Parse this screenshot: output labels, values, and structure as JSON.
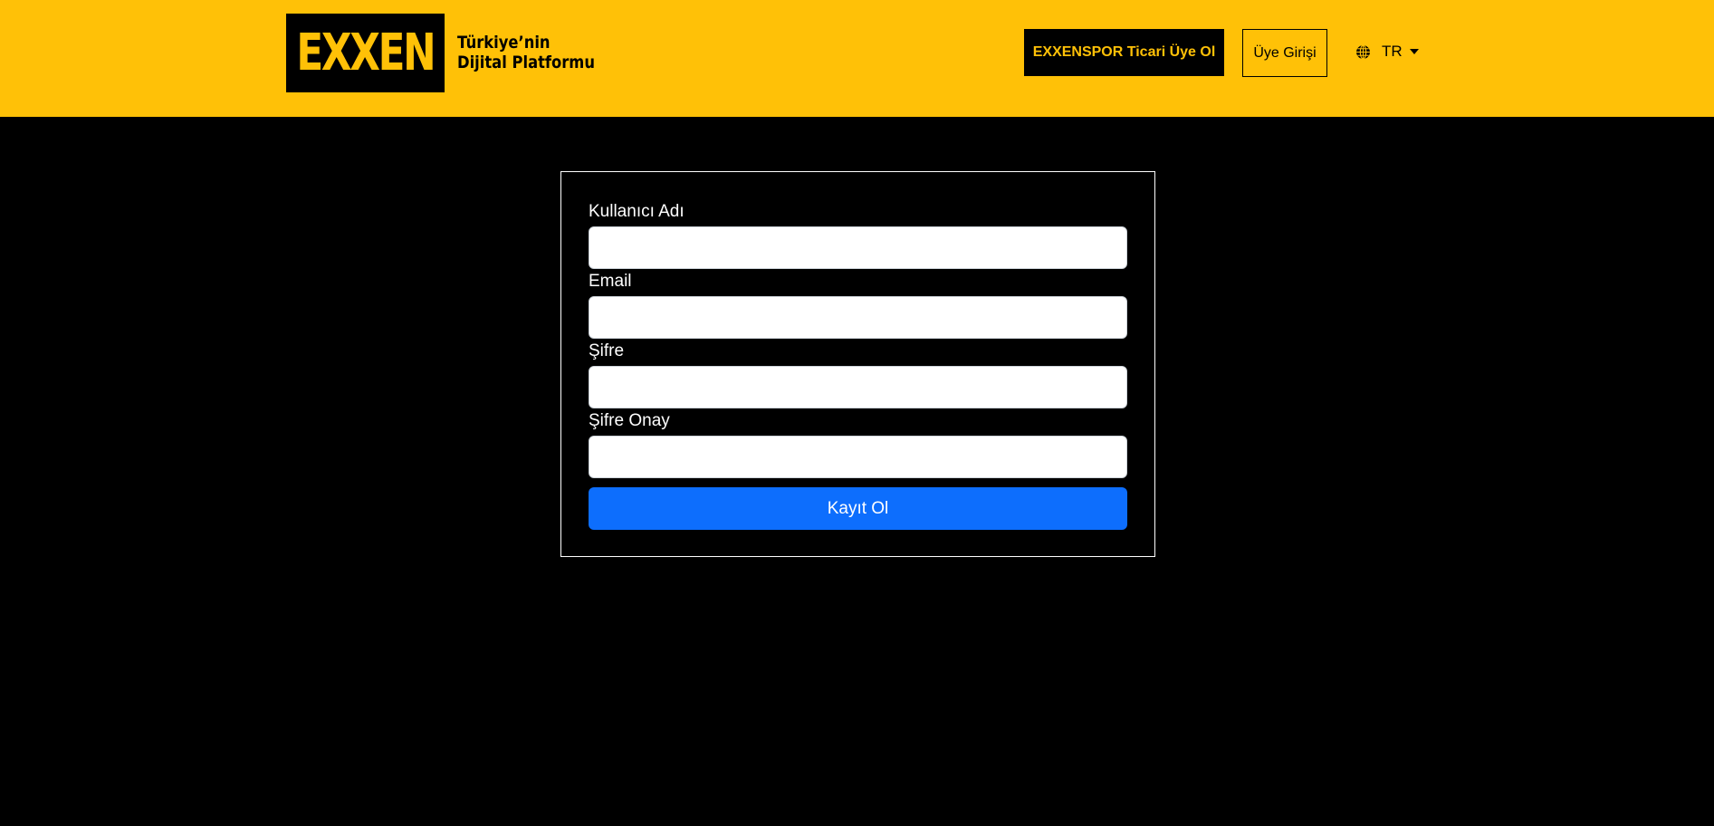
{
  "header": {
    "logo_text": "EXXEN",
    "tagline_line1": "Türkiye’nin",
    "tagline_line2": "Dijital Platformu",
    "spor_button_label": "EXXENSPOR Ticari Üye Ol",
    "login_button_label": "Üye Girişi",
    "language_label": "TR",
    "language_icon": "globe-icon",
    "language_caret_icon": "caret-down-icon"
  },
  "form": {
    "username_label": "Kullanıcı Adı",
    "username_value": "",
    "email_label": "Email",
    "email_value": "",
    "password_label": "Şifre",
    "password_value": "",
    "password_confirm_label": "Şifre Onay",
    "password_confirm_value": "",
    "submit_label": "Kayıt Ol"
  },
  "colors": {
    "header_bg": "#FFC107",
    "page_bg": "#000000",
    "primary_button": "#0D6EFD"
  }
}
